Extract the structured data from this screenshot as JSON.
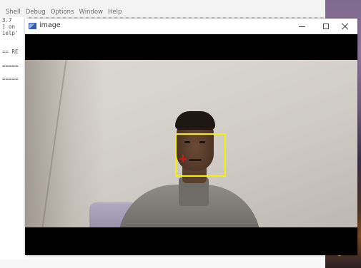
{
  "shell": {
    "menu": [
      "Shell",
      "Debug",
      "Options",
      "Window",
      "Help"
    ],
    "text_lines": [
      "3.7",
      "] on",
      "ielp'",
      "== RE",
      "=====",
      "====="
    ]
  },
  "cv_window": {
    "title": "image",
    "icon": "app-window-icon",
    "controls": {
      "minimize": "minimize-icon",
      "maximize": "maximize-icon",
      "close": "close-icon"
    }
  },
  "overlay_colors": {
    "face_box": "#f5f200",
    "target_marker": "#c41a1a"
  }
}
